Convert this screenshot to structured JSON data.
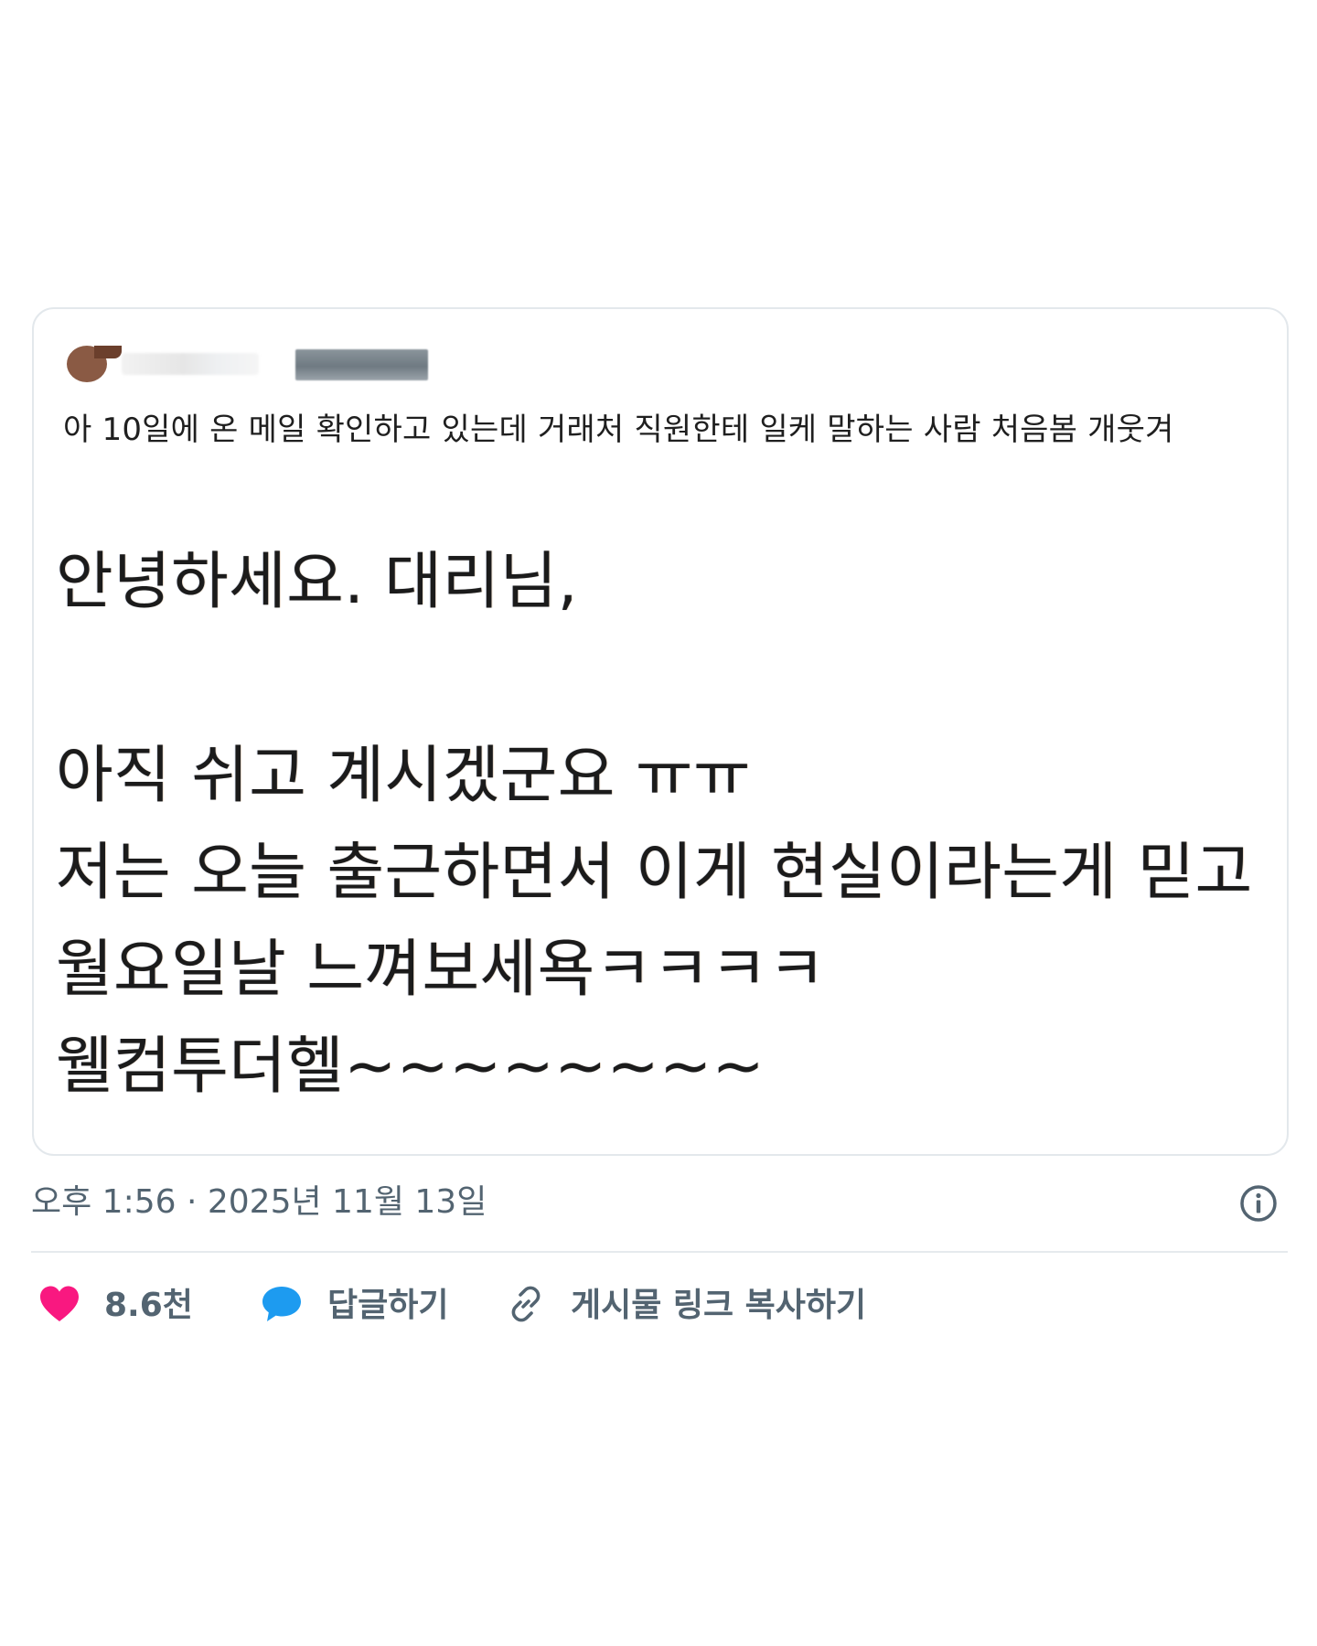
{
  "post": {
    "author_name": "",
    "author_handle": "",
    "caption": "아 10일에 온 메일 확인하고 있는데 거래처 직원한테 일케 말하는 사람 처음봄 개웃겨",
    "mail_lines": [
      "안녕하세요. 대리님,",
      "",
      "아직 쉬고 계시겠군요 ㅠㅠ",
      "저는 오늘 출근하면서 이게 현실이라는게 믿고",
      "월요일날 느껴보세욕ㅋㅋㅋㅋ",
      "웰컴투더헬~~~~~~~~"
    ],
    "timestamp": "오후 1:56 · 2025년 11월 13일"
  },
  "actions": {
    "like_count": "8.6천",
    "reply_label": "답글하기",
    "copy_link_label": "게시물 링크 복사하기"
  },
  "colors": {
    "like": "#f91880",
    "reply": "#1d9bf0",
    "muted": "#536471"
  },
  "icons": {
    "like": "heart-icon",
    "reply": "speech-bubble-icon",
    "copy": "link-icon",
    "info": "info-icon"
  }
}
